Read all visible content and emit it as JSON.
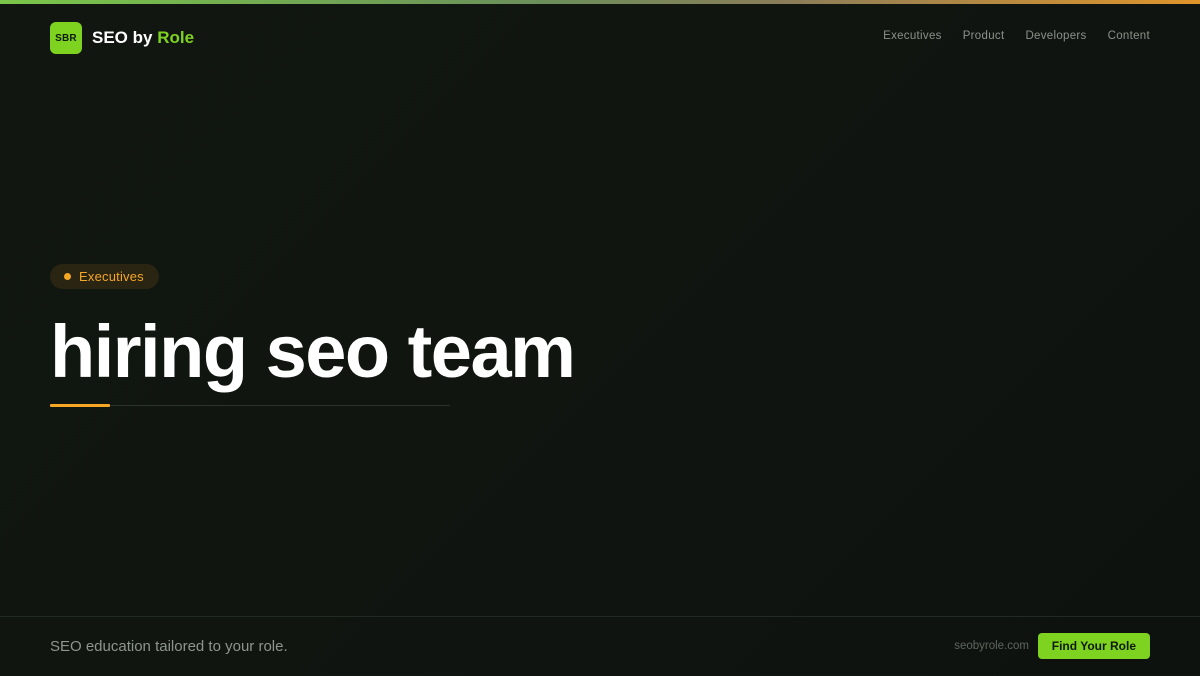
{
  "brand": {
    "badge": "SBR",
    "name_prefix": "SEO by",
    "name_accent": "Role",
    "accent_color": "#7ed321"
  },
  "nav": {
    "items": [
      {
        "label": "Executives"
      },
      {
        "label": "Product"
      },
      {
        "label": "Developers"
      },
      {
        "label": "Content"
      }
    ]
  },
  "hero": {
    "category": "Executives",
    "category_color": "#f5a623",
    "title": "hiring seo team"
  },
  "footer": {
    "tagline": "SEO education tailored to your role.",
    "domain": "seobyrole.com",
    "cta_label": "Find Your Role"
  }
}
